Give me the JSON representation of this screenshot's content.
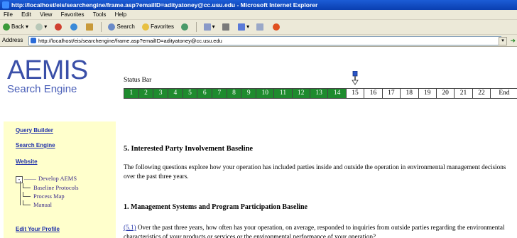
{
  "window": {
    "title": "http://localhost/eis/searchengine/frame.asp?emailID=adityatoney@cc.usu.edu - Microsoft Internet Explorer"
  },
  "menu": [
    "File",
    "Edit",
    "View",
    "Favorites",
    "Tools",
    "Help"
  ],
  "toolbar": {
    "back": "Back",
    "search": "Search",
    "favorites": "Favorites"
  },
  "address": {
    "label": "Address",
    "url": "http://localhost/eis/searchengine/frame.asp?emailID=adityatoney@cc.usu.edu"
  },
  "sidebar": {
    "logo_main": "AEMIS",
    "logo_sub": "Search Engine",
    "links": {
      "query_builder": "Query Builder",
      "search_engine": "Search Engine",
      "website": "Website",
      "edit_profile": "Edit Your Profile"
    },
    "tree": {
      "toggle": "-",
      "root": "Develop AEMS",
      "children": [
        "Baseline Protocols",
        "Process Map",
        "Manual"
      ]
    }
  },
  "main": {
    "status_label": "Status Bar",
    "status_cells": [
      "1",
      "2",
      "3",
      "4",
      "5",
      "6",
      "7",
      "8",
      "9",
      "10",
      "11",
      "12",
      "13",
      "14",
      "15",
      "16",
      "17",
      "18",
      "19",
      "20",
      "21",
      "22",
      "End"
    ],
    "completed_count": 14,
    "colors": {
      "done": "#1e8b2e",
      "link": "#2233aa"
    },
    "section_title": "5. Interested Party Involvement Baseline",
    "intro": "The following questions explore how your operation has included parties inside and outside the operation in environmental management decisions over the past three years.",
    "subsection_title": "1. Management Systems and Program Participation Baseline",
    "question_ref": "(5.1)",
    "question_text": " Over the past three years, how often has your operation, on average, responded to inquiries from outside parties regarding the environmental characteristics of your products or services or the environmental performance of your operation?"
  }
}
